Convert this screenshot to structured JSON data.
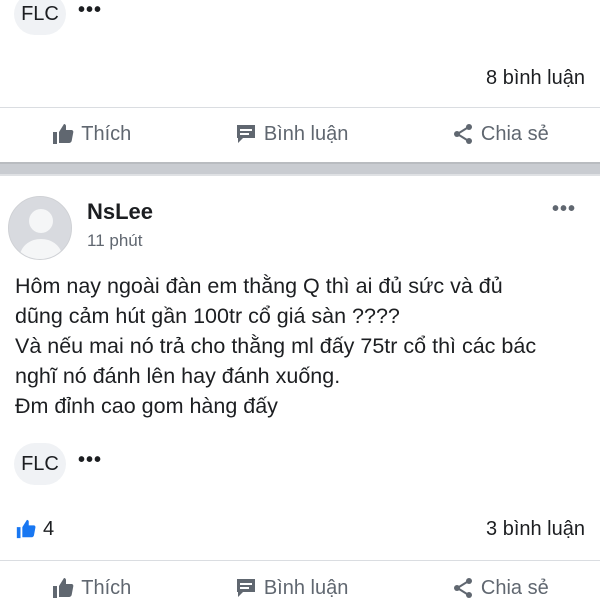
{
  "post1": {
    "tag": "FLC",
    "comments": "8 bình luận"
  },
  "actions": {
    "like": "Thích",
    "comment": "Bình luận",
    "share": "Chia sẻ"
  },
  "post2": {
    "author": "NsLee",
    "time": "11 phút",
    "body_lines": [
      "Hôm nay ngoài đàn em thằng Q thì ai đủ sức và đủ",
      "dũng cảm hút gần 100tr cổ giá sàn ????",
      "Và nếu mai nó trả cho thằng ml đấy 75tr cổ thì các bác",
      "nghĩ nó đánh lên hay đánh xuống.",
      "Đm đỉnh cao gom hàng đấy"
    ],
    "tag": "FLC",
    "likes": "4",
    "comments": "3 bình luận"
  },
  "icons": {
    "like": "thumbs-up-icon",
    "comment": "chat-bubble-icon",
    "share": "share-icon",
    "more": "ellipsis-icon"
  },
  "colors": {
    "like_blue": "#1877f2",
    "action_gray": "#606770",
    "separator": "#c9ccd1"
  }
}
